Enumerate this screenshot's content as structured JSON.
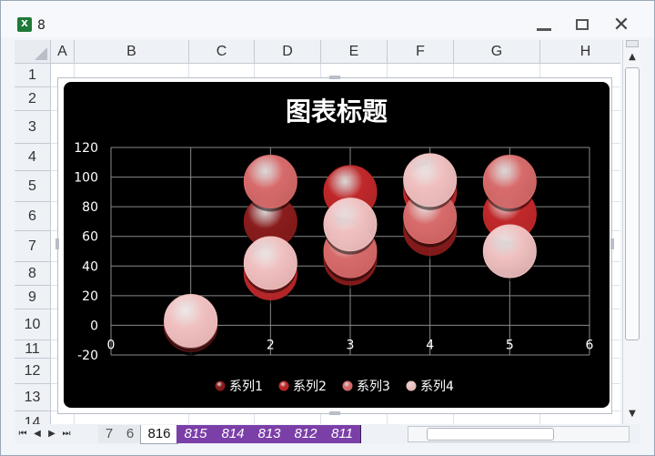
{
  "window": {
    "title": "8"
  },
  "columns": [
    "A",
    "B",
    "C",
    "D",
    "E",
    "F",
    "G",
    "H"
  ],
  "rows": [
    "1",
    "2",
    "3",
    "4",
    "5",
    "6",
    "7",
    "8",
    "9",
    "10",
    "11",
    "12",
    "13",
    "14"
  ],
  "sheet_tabs": [
    "7",
    "6",
    "816",
    "815",
    "814",
    "813",
    "812",
    "811"
  ],
  "active_sheet": "816",
  "chart_data": {
    "type": "scatter",
    "bubble": true,
    "title": "图表标题",
    "xlim": [
      0,
      6
    ],
    "ylim": [
      -20,
      120
    ],
    "xticks": [
      0,
      1,
      2,
      3,
      4,
      5,
      6
    ],
    "yticks": [
      -20,
      0,
      20,
      40,
      60,
      80,
      100,
      120
    ],
    "grid": true,
    "legend_position": "bottom",
    "series": [
      {
        "name": "系列1",
        "color": "#8a1c1c",
        "x": [
          1,
          2,
          3,
          4,
          5
        ],
        "y": [
          0,
          70,
          45,
          65,
          75
        ]
      },
      {
        "name": "系列2",
        "color": "#c0282a",
        "x": [
          1,
          2,
          3,
          4,
          5
        ],
        "y": [
          0,
          35,
          90,
          90,
          75
        ]
      },
      {
        "name": "系列3",
        "color": "#d86b6b",
        "x": [
          1,
          2,
          3,
          4,
          5
        ],
        "y": [
          2,
          97,
          50,
          73,
          97
        ]
      },
      {
        "name": "系列4",
        "color": "#f0c0c0",
        "x": [
          1,
          2,
          3,
          4,
          5
        ],
        "y": [
          3,
          42,
          68,
          98,
          50
        ]
      }
    ]
  }
}
